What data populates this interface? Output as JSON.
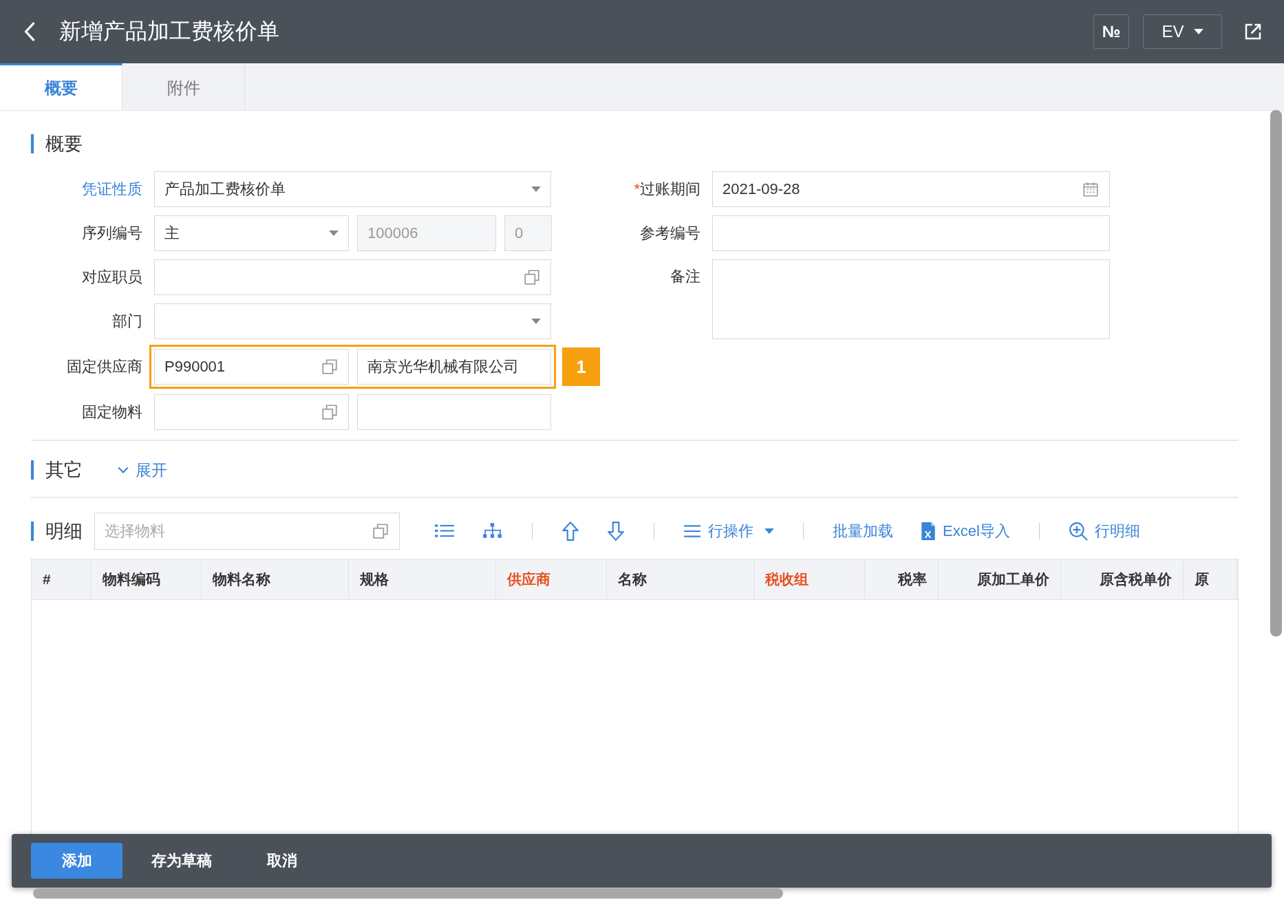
{
  "header": {
    "title": "新增产品加工费核价单",
    "number_button": "№",
    "language": "EV"
  },
  "tabs": [
    {
      "label": "概要",
      "selected": true
    },
    {
      "label": "附件",
      "selected": false
    }
  ],
  "summary": {
    "title": "概要",
    "left_fields": [
      {
        "label": "凭证性质",
        "label_link": true,
        "kind": "select",
        "value": "产品加工费核价单"
      },
      {
        "label": "序列编号",
        "label_link": false,
        "kind": "sequence",
        "value": "主",
        "number": "100006",
        "suffix": "0"
      },
      {
        "label": "对应职员",
        "label_link": false,
        "kind": "lookup"
      },
      {
        "label": "部门",
        "label_link": false,
        "kind": "select"
      },
      {
        "label": "固定供应商",
        "label_link": false,
        "kind": "lookup_pair",
        "code": "P990001",
        "name": "南京光华机械有限公司",
        "highlighted": true,
        "badge": "1"
      },
      {
        "label": "固定物料",
        "label_link": false,
        "kind": "lookup_pair",
        "highlighted": false
      }
    ],
    "right_fields": [
      {
        "label": "过账期间",
        "required_mark": "*",
        "kind": "date",
        "value": "2021-09-28"
      },
      {
        "label": "参考编号",
        "kind": "text"
      },
      {
        "label": "备注",
        "kind": "textarea"
      }
    ]
  },
  "other": {
    "title": "其它",
    "toggle": "展开",
    "expanded": false
  },
  "detail": {
    "title": "明细",
    "search_placeholder": "选择物料",
    "toolbar": [
      {
        "kind": "list"
      },
      {
        "kind": "hierarchy"
      },
      {
        "kind": "separator"
      },
      {
        "kind": "moveup"
      },
      {
        "kind": "movedown"
      },
      {
        "kind": "separator"
      },
      {
        "kind": "menu",
        "label": "行操作"
      },
      {
        "kind": "separator"
      },
      {
        "kind": "button",
        "label": "批量加载"
      },
      {
        "kind": "excel",
        "label": "Excel导入"
      },
      {
        "kind": "separator"
      },
      {
        "kind": "zoom",
        "label": "行明细"
      }
    ],
    "columns": [
      {
        "label": "#",
        "required": false
      },
      {
        "label": "物料编码",
        "required": false
      },
      {
        "label": "物料名称",
        "required": false
      },
      {
        "label": "规格",
        "required": false
      },
      {
        "label": "供应商",
        "required": true
      },
      {
        "label": "名称",
        "required": false
      },
      {
        "label": "税收组",
        "required": true
      },
      {
        "label": "税率",
        "required": false
      },
      {
        "label": "原加工单价",
        "required": false
      },
      {
        "label": "原含税单价",
        "required": false
      },
      {
        "label": "原",
        "required": false
      }
    ]
  },
  "footer": [
    {
      "label": "添加",
      "primary": true
    },
    {
      "label": "存为草稿",
      "primary": false
    },
    {
      "label": "取消",
      "primary": false
    }
  ]
}
